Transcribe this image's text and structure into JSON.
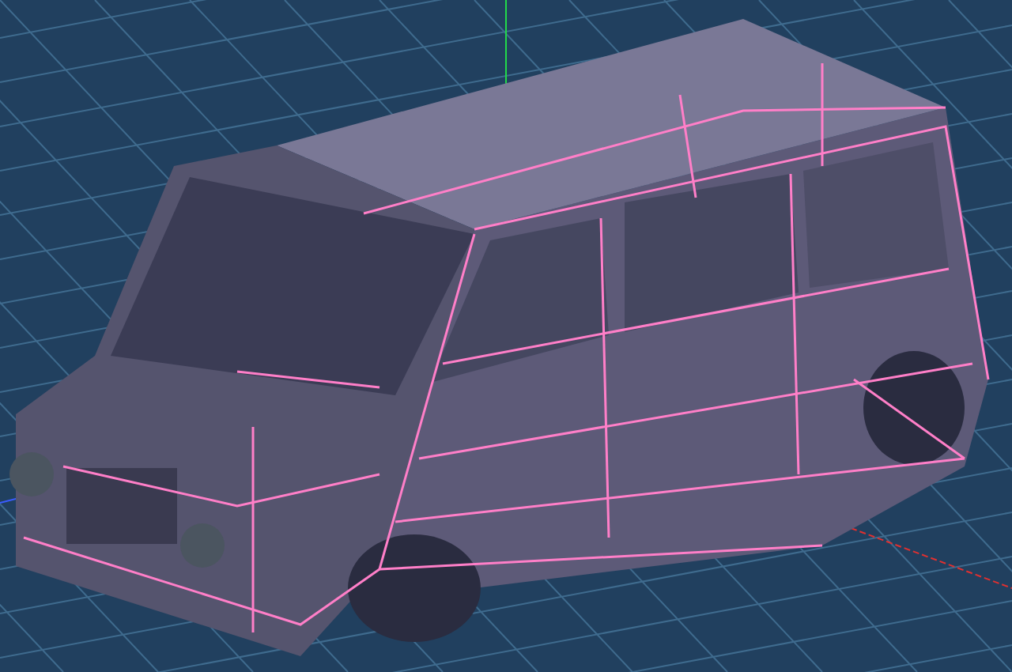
{
  "viewport": {
    "grid": true,
    "axes": true,
    "wireframe": true
  }
}
